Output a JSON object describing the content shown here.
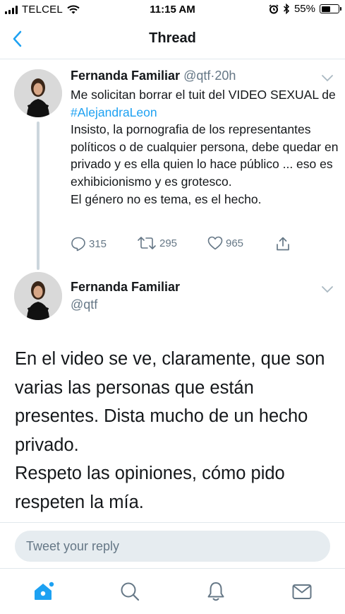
{
  "status_bar": {
    "carrier": "TELCEL",
    "time": "11:15 AM",
    "battery": "55%",
    "battery_level": 0.55,
    "icons": [
      "signal-bars-icon",
      "wifi-icon",
      "alarm-icon",
      "bluetooth-icon",
      "battery-icon"
    ]
  },
  "nav": {
    "title": "Thread",
    "back_icon": "chevron-left-icon"
  },
  "tweet1": {
    "name": "Fernanda Familiar",
    "handle": "@qtf",
    "separator": "·",
    "time": "20h",
    "text_before_hashtag": "Me solicitan borrar el tuit del VIDEO SEXUAL de ",
    "hashtag": "#AlejandraLeon",
    "text_after_hashtag": "Insisto, la pornografia de los representantes políticos o de cualquier persona, debe quedar en privado y es ella quien lo hace público ... eso es exhibicionismo y es grotesco.",
    "text_last": "El género no es tema, es el hecho.",
    "replies": "315",
    "retweets": "295",
    "likes": "965"
  },
  "tweet2": {
    "name": "Fernanda Familiar",
    "handle": "@qtf",
    "text_p1": "En el video se ve, claramente, que son varias las personas que están presentes. Dista mucho de un hecho privado.",
    "text_p2": "Respeto las opiniones, cómo pido respeten la mía."
  },
  "reply": {
    "placeholder": "Tweet your reply"
  },
  "tabs": [
    {
      "name": "home",
      "icon": "home-icon"
    },
    {
      "name": "search",
      "icon": "search-icon"
    },
    {
      "name": "notifications",
      "icon": "bell-icon"
    },
    {
      "name": "messages",
      "icon": "mail-icon"
    }
  ],
  "colors": {
    "accent": "#1da1f2",
    "secondary_text": "#657786",
    "primary_text": "#14171a",
    "divider": "#e1e8ed",
    "input_bg": "#e6ecf0"
  }
}
